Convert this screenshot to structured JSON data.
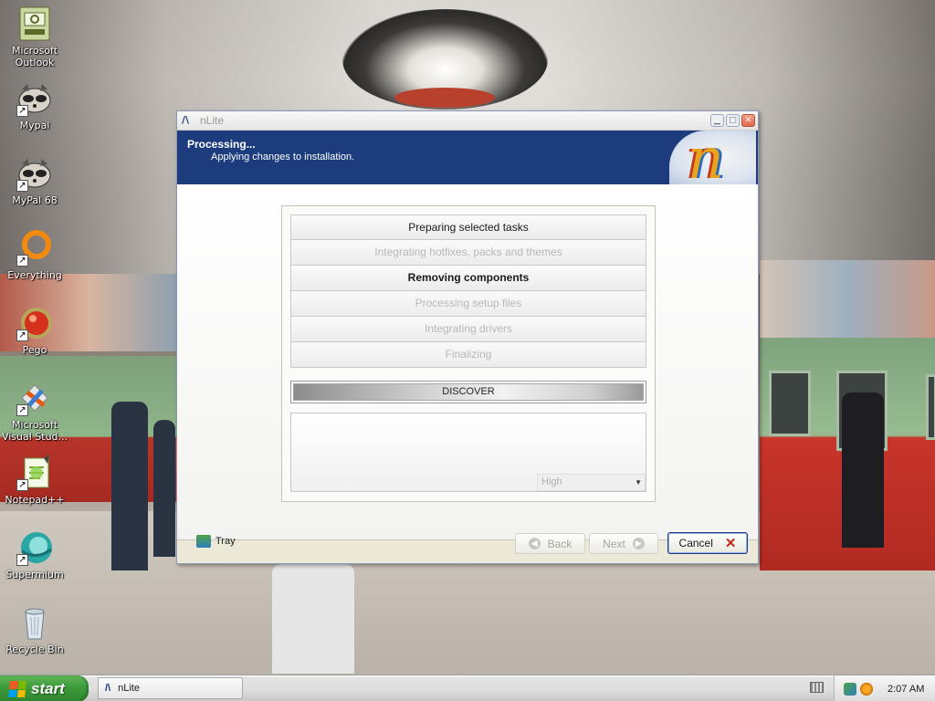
{
  "desktop": {
    "icons": [
      {
        "label": "Microsoft Outlook",
        "icon": "outlook-icon"
      },
      {
        "label": "Mypal",
        "icon": "mypal-icon"
      },
      {
        "label": "MyPal 68",
        "icon": "mypal68-icon"
      },
      {
        "label": "Everything",
        "icon": "everything-icon"
      },
      {
        "label": "Pego",
        "icon": "pego-icon"
      },
      {
        "label": "Microsoft Visual Stud...",
        "icon": "visual-studio-icon"
      },
      {
        "label": "Notepad++",
        "icon": "notepadpp-icon"
      },
      {
        "label": "Supermium",
        "icon": "supermium-icon"
      },
      {
        "label": "Recycle Bin",
        "icon": "recycle-bin-icon"
      }
    ]
  },
  "window": {
    "title": "nLite",
    "header": {
      "title": "Processing...",
      "subtitle": "Applying changes to installation.",
      "logo_text": "n"
    },
    "steps": [
      {
        "label": "Preparing selected tasks",
        "state": "done"
      },
      {
        "label": "Integrating hotfixes, packs and themes",
        "state": "skipped"
      },
      {
        "label": "Removing components",
        "state": "active"
      },
      {
        "label": "Processing setup files",
        "state": "pending"
      },
      {
        "label": "Integrating drivers",
        "state": "pending"
      },
      {
        "label": "Finalizing",
        "state": "pending"
      }
    ],
    "progress": {
      "label": "DISCOVER",
      "value": 1.0
    },
    "priority": {
      "selected": "High"
    },
    "buttons": {
      "tray": "Tray",
      "back": "Back",
      "next": "Next",
      "cancel": "Cancel"
    }
  },
  "taskbar": {
    "start_label": "start",
    "task_item": "nLite",
    "clock": "2:07 AM"
  },
  "colors": {
    "header_bg": "#1c3c7e",
    "start_green": "#3c9b39",
    "cancel_x": "#c22a1b"
  }
}
